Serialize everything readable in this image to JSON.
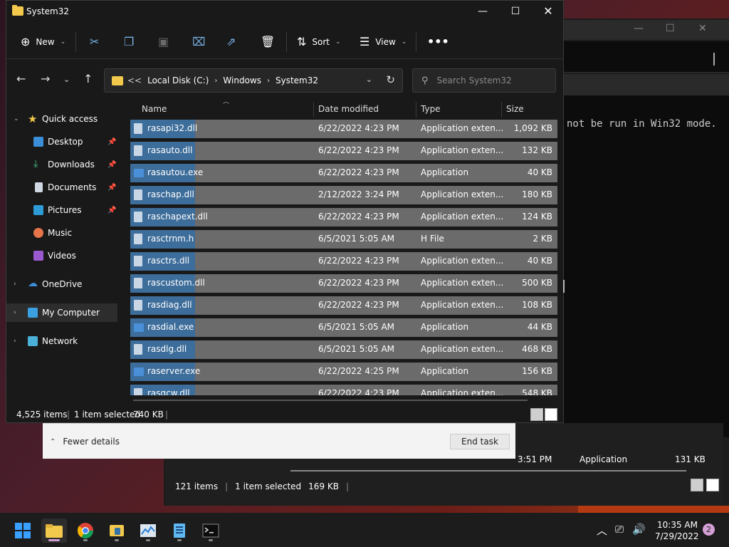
{
  "window": {
    "title": "System32"
  },
  "toolbar": {
    "new_label": "New",
    "sort_label": "Sort",
    "view_label": "View"
  },
  "address": {
    "overflow": "<<",
    "segments": [
      "Local Disk (C:)",
      "Windows",
      "System32"
    ]
  },
  "search": {
    "placeholder": "Search System32"
  },
  "nav": {
    "quick_access": "Quick access",
    "items": [
      "Desktop",
      "Downloads",
      "Documents",
      "Pictures",
      "Music",
      "Videos"
    ],
    "onedrive": "OneDrive",
    "my_computer": "My Computer",
    "network": "Network"
  },
  "columns": {
    "name": "Name",
    "date": "Date modified",
    "type": "Type",
    "size": "Size"
  },
  "files": [
    {
      "name": "rasapi32.dll",
      "date": "6/22/2022 4:23 PM",
      "type": "Application exten...",
      "size": "1,092 KB",
      "kind": "dll"
    },
    {
      "name": "rasauto.dll",
      "date": "6/22/2022 4:23 PM",
      "type": "Application exten...",
      "size": "132 KB",
      "kind": "dll"
    },
    {
      "name": "rasautou.exe",
      "date": "6/22/2022 4:23 PM",
      "type": "Application",
      "size": "40 KB",
      "kind": "exe"
    },
    {
      "name": "raschap.dll",
      "date": "2/12/2022 3:24 PM",
      "type": "Application exten...",
      "size": "180 KB",
      "kind": "dll"
    },
    {
      "name": "raschapext.dll",
      "date": "6/22/2022 4:23 PM",
      "type": "Application exten...",
      "size": "124 KB",
      "kind": "dll"
    },
    {
      "name": "rasctrnm.h",
      "date": "6/5/2021 5:05 AM",
      "type": "H File",
      "size": "2 KB",
      "kind": "dll"
    },
    {
      "name": "rasctrs.dll",
      "date": "6/22/2022 4:23 PM",
      "type": "Application exten...",
      "size": "40 KB",
      "kind": "dll"
    },
    {
      "name": "rascustom.dll",
      "date": "6/22/2022 4:23 PM",
      "type": "Application exten...",
      "size": "500 KB",
      "kind": "dll"
    },
    {
      "name": "rasdiag.dll",
      "date": "6/22/2022 4:23 PM",
      "type": "Application exten...",
      "size": "108 KB",
      "kind": "dll"
    },
    {
      "name": "rasdial.exe",
      "date": "6/5/2021 5:05 AM",
      "type": "Application",
      "size": "44 KB",
      "kind": "exe"
    },
    {
      "name": "rasdlg.dll",
      "date": "6/5/2021 5:05 AM",
      "type": "Application exten...",
      "size": "468 KB",
      "kind": "dll"
    },
    {
      "name": "raserver.exe",
      "date": "6/22/2022 4:25 PM",
      "type": "Application",
      "size": "156 KB",
      "kind": "exe"
    },
    {
      "name": "rasgcw.dll",
      "date": "6/22/2022 4:23 PM",
      "type": "Application exten...",
      "size": "548 KB",
      "kind": "dll"
    }
  ],
  "status": {
    "count": "4,525 items",
    "selected": "1 item selected",
    "size": "740 KB"
  },
  "background": {
    "terminal_text": "not be run in Win32 mode.",
    "fewer_details": "Fewer details",
    "end_task": "End task",
    "row_time": "3:51 PM",
    "row_type": "Application",
    "row_size": "131 KB",
    "status_count": "121 items",
    "status_selected": "1 item selected",
    "status_size": "169 KB"
  },
  "clock": {
    "time": "10:35 AM",
    "date": "7/29/2022"
  },
  "notifications": {
    "count": "2"
  }
}
